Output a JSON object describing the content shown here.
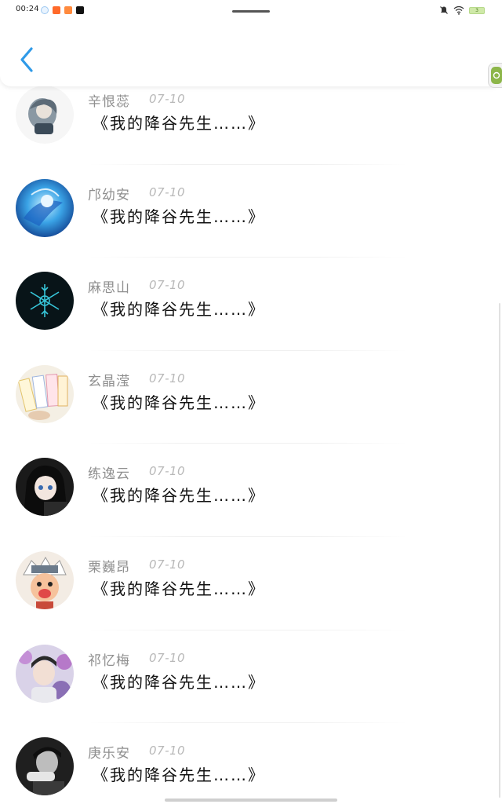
{
  "status_bar": {
    "time": "00:24",
    "battery_level": "3"
  },
  "header": {
    "back_icon": "chevron-left-icon",
    "accent_color": "#2f9ae8"
  },
  "messages": [
    {
      "name": "辛恨蕊",
      "date": "07-10",
      "text": "《我的降谷先生……》",
      "avatar": "girl-with-gray-hair"
    },
    {
      "name": "邝幼安",
      "date": "07-10",
      "text": "《我的降谷先生……》",
      "avatar": "blue-anime-art"
    },
    {
      "name": "麻思山",
      "date": "07-10",
      "text": "《我的降谷先生……》",
      "avatar": "cyan-snowflake"
    },
    {
      "name": "玄晶滢",
      "date": "07-10",
      "text": "《我的降谷先生……》",
      "avatar": "stationery-cards"
    },
    {
      "name": "练逸云",
      "date": "07-10",
      "text": "《我的降谷先生……》",
      "avatar": "anime-girl-dark-hair"
    },
    {
      "name": "栗巍昂",
      "date": "07-10",
      "text": "《我的降谷先生……》",
      "avatar": "chibi-ninja"
    },
    {
      "name": "祁忆梅",
      "date": "07-10",
      "text": "《我的降谷先生……》",
      "avatar": "boy-with-flowers"
    },
    {
      "name": "庚乐安",
      "date": "07-10",
      "text": "《我的降谷先生……》",
      "avatar": "monochrome-figure"
    }
  ]
}
